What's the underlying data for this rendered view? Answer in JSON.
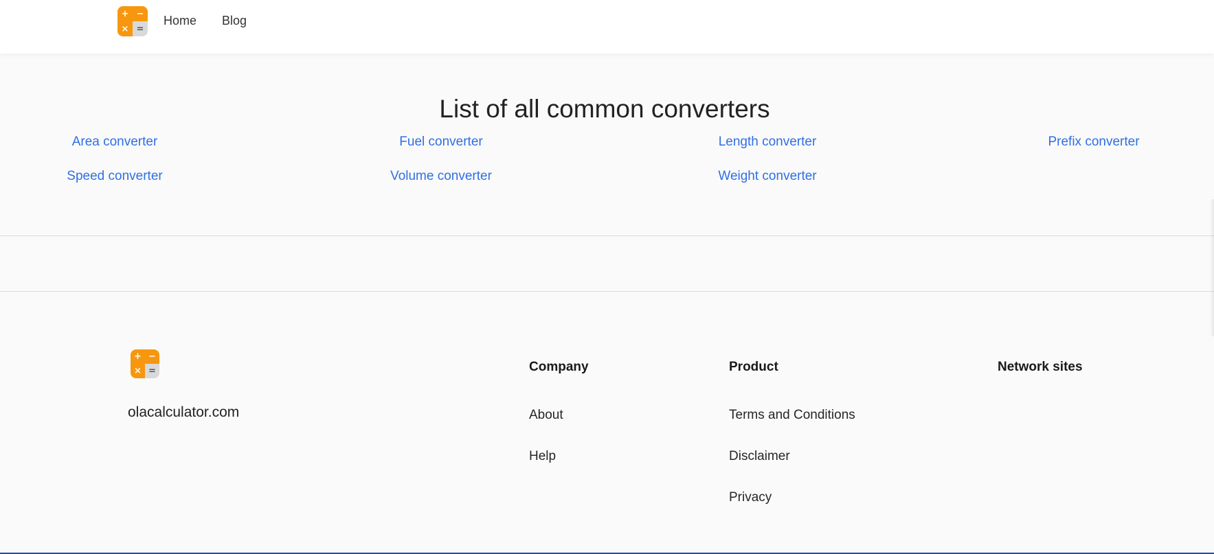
{
  "header": {
    "logo_icon": "calculator-icon",
    "nav": [
      {
        "label": "Home"
      },
      {
        "label": "Blog"
      }
    ]
  },
  "converters": {
    "title": "List of all common converters",
    "links": [
      {
        "label": "Area converter"
      },
      {
        "label": "Fuel converter"
      },
      {
        "label": "Length converter"
      },
      {
        "label": "Prefix converter"
      },
      {
        "label": "Speed converter"
      },
      {
        "label": "Volume converter"
      },
      {
        "label": "Weight converter"
      }
    ]
  },
  "footer": {
    "site_name": "olacalculator.com",
    "company": {
      "heading": "Company",
      "links": [
        "About",
        "Help"
      ]
    },
    "product": {
      "heading": "Product",
      "links": [
        "Terms and Conditions",
        "Disclaimer",
        "Privacy"
      ]
    },
    "network": {
      "heading": "Network sites"
    }
  },
  "colors": {
    "accent_orange": "#f7970f",
    "link_blue": "#2f6fe4",
    "bottom_bar": "#1d4fa0"
  },
  "logo_glyphs": {
    "plus": "+",
    "minus": "−",
    "times": "×",
    "equals": "="
  }
}
